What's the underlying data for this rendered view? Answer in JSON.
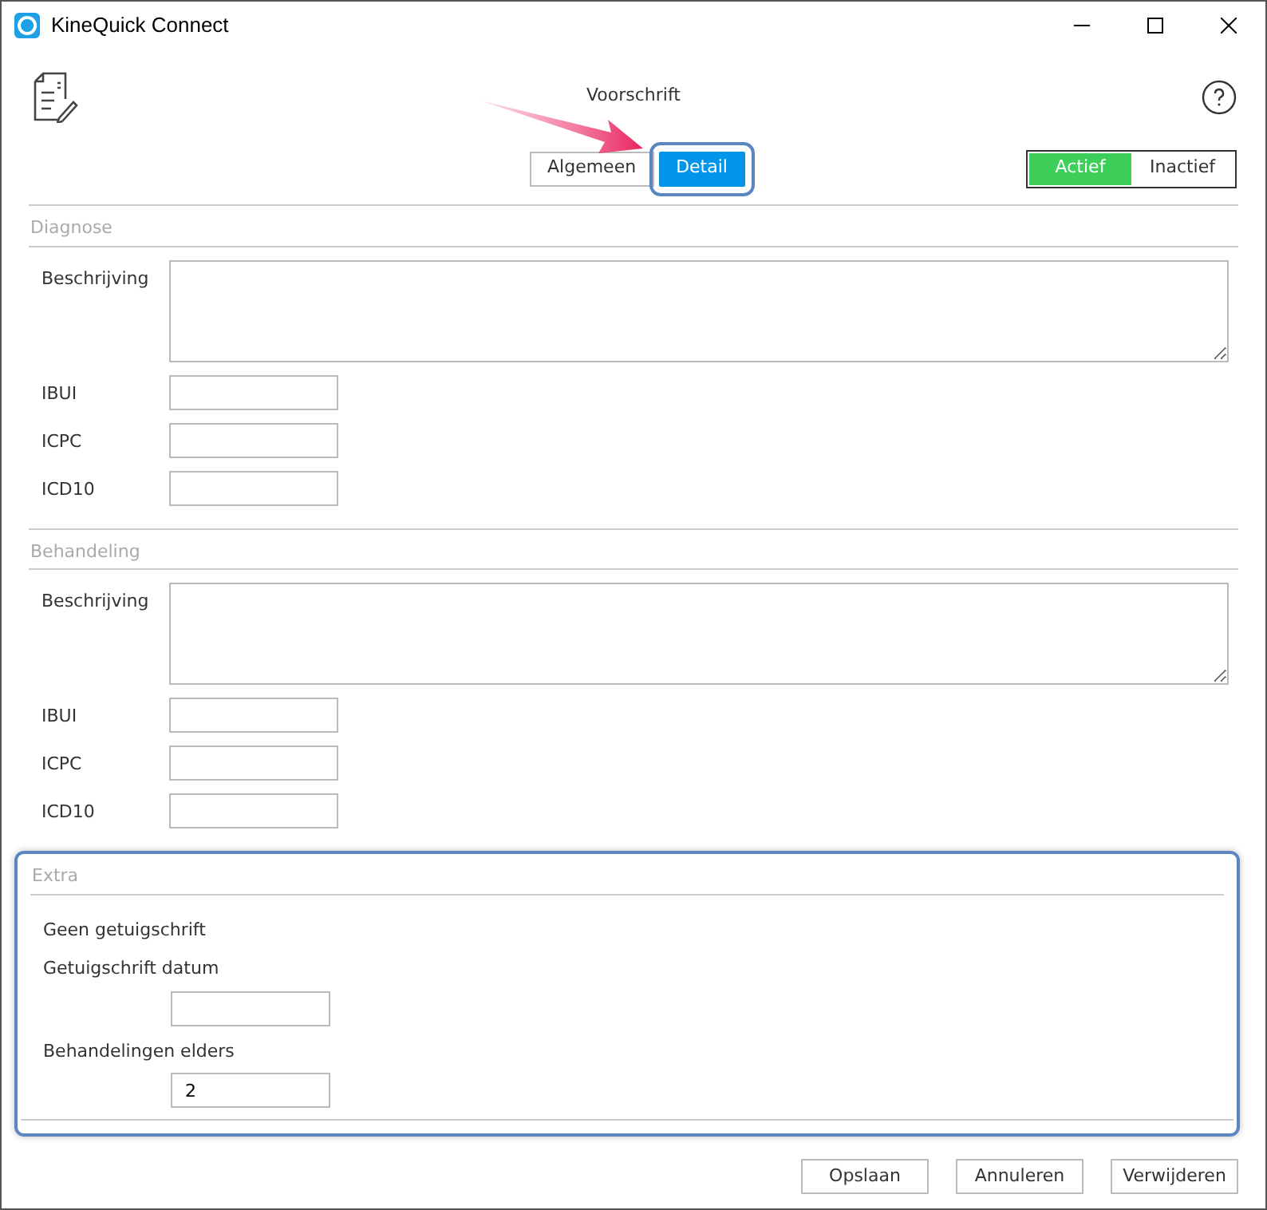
{
  "window": {
    "title": "KineQuick Connect"
  },
  "header": {
    "title": "Voorschrift"
  },
  "tabs": [
    {
      "label": "Algemeen",
      "selected": false,
      "highlighted": false
    },
    {
      "label": "Detail",
      "selected": true,
      "highlighted": true
    }
  ],
  "status_toggle": [
    {
      "label": "Actief",
      "selected": true
    },
    {
      "label": "Inactief",
      "selected": false
    }
  ],
  "sections": [
    {
      "title": "Diagnose",
      "highlighted": false,
      "fields": [
        {
          "kind": "textarea",
          "label": "Beschrijving"
        },
        {
          "kind": "input",
          "label": "IBUI"
        },
        {
          "kind": "input",
          "label": "ICPC"
        },
        {
          "kind": "input",
          "label": "ICD10"
        }
      ]
    },
    {
      "title": "Behandeling",
      "highlighted": false,
      "fields": [
        {
          "kind": "textarea",
          "label": "Beschrijving"
        },
        {
          "kind": "input",
          "label": "IBUI"
        },
        {
          "kind": "input",
          "label": "ICPC"
        },
        {
          "kind": "input",
          "label": "ICD10"
        }
      ]
    },
    {
      "title": "Extra",
      "highlighted": true,
      "fields": [
        {
          "kind": "note",
          "label": "Geen getuigschrift"
        },
        {
          "kind": "input_below",
          "label": "Getuigschrift datum"
        },
        {
          "kind": "input_below",
          "label": "Behandelingen elders",
          "value": "2"
        }
      ]
    }
  ],
  "buttons": [
    "Opslaan",
    "Annuleren",
    "Verwijderen"
  ]
}
